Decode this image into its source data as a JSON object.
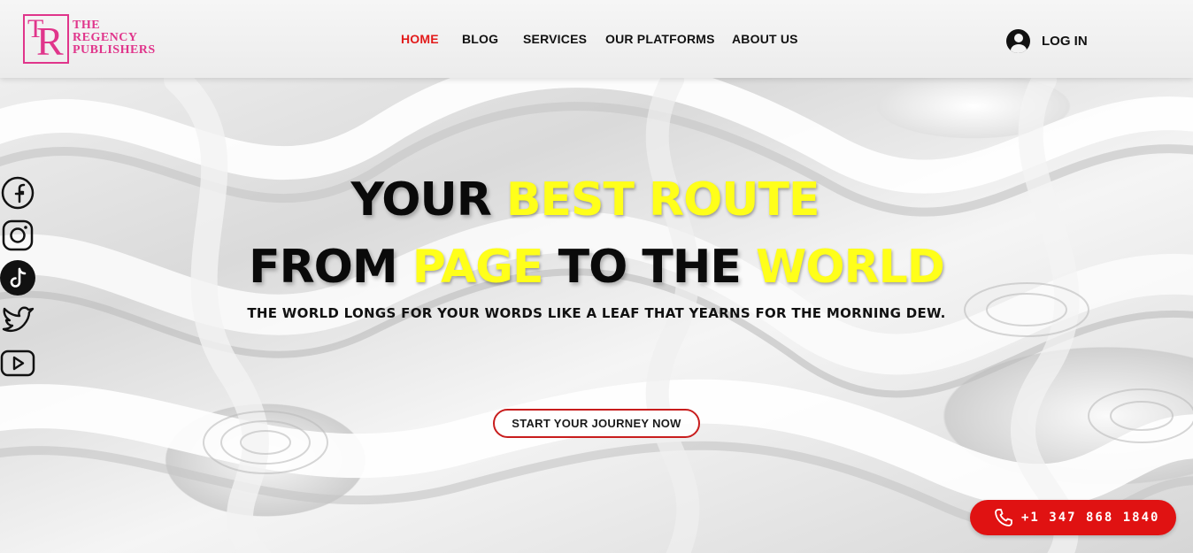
{
  "brand": {
    "logo_mark": "TR",
    "name_lines": [
      "THE",
      "REGENCY",
      "PUBLISHERS"
    ]
  },
  "nav": {
    "items": [
      {
        "label": "HOME",
        "active": true
      },
      {
        "label": "BLOG",
        "active": false
      },
      {
        "label": "SERVICES",
        "active": false
      },
      {
        "label": "OUR PLATFORMS",
        "active": false
      },
      {
        "label": "ABOUT US",
        "active": false
      }
    ]
  },
  "login": {
    "label": "LOG IN",
    "icon": "user-avatar-icon"
  },
  "social": [
    {
      "name": "facebook",
      "icon": "facebook-icon"
    },
    {
      "name": "instagram",
      "icon": "instagram-icon"
    },
    {
      "name": "tiktok",
      "icon": "tiktok-icon"
    },
    {
      "name": "twitter",
      "icon": "twitter-icon"
    },
    {
      "name": "youtube",
      "icon": "youtube-icon"
    }
  ],
  "hero": {
    "line1": {
      "part1": "YOUR",
      "part2": "BEST ROUTE"
    },
    "line2": {
      "part1": "FROM",
      "part2": "PAGE",
      "part3": "TO THE",
      "part4": "WORLD"
    },
    "tagline": "THE WORLD LONGS FOR YOUR WORDS LIKE A LEAF THAT YEARNS FOR THE MORNING DEW.",
    "cta_label": "START YOUR JOURNEY NOW"
  },
  "contact": {
    "phone": "+1 347 868 1840",
    "icon": "phone-icon"
  },
  "colors": {
    "accent_red": "#e21b1b",
    "highlight_yellow": "#ffff1a",
    "brand_pink": "#e0358b",
    "phone_bg": "#e01212"
  }
}
